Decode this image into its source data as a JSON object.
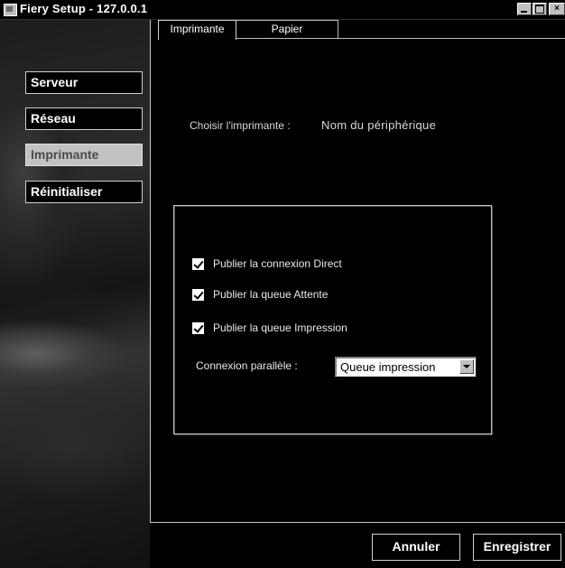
{
  "window": {
    "title": "Fiery Setup - 127.0.0.1",
    "controls": {
      "minimize": "_",
      "maximize": "□",
      "close": "×"
    }
  },
  "sidebar": {
    "items": [
      {
        "label": "Serveur",
        "active": false
      },
      {
        "label": "Réseau",
        "active": false
      },
      {
        "label": "Imprimante",
        "active": true
      },
      {
        "label": "Réinitialiser",
        "active": false
      }
    ]
  },
  "tabs": [
    {
      "label": "Imprimante",
      "selected": true
    },
    {
      "label": "Papier",
      "selected": false
    }
  ],
  "printer": {
    "label": "Choisir l'imprimante :",
    "value": "Nom du périphérique"
  },
  "options": {
    "checkboxes": [
      {
        "label": "Publier la connexion Direct",
        "checked": true
      },
      {
        "label": "Publier la queue Attente",
        "checked": true
      },
      {
        "label": "Publier la queue Impression",
        "checked": true
      }
    ],
    "parallel": {
      "label": "Connexion parallèle :",
      "selected": "Queue impression"
    }
  },
  "footer": {
    "cancel_label": "Annuler",
    "save_label": "Enregistrer"
  },
  "colors": {
    "background": "#000000",
    "active_nav": "#c2c2c2",
    "border": "#d0d0d0"
  }
}
